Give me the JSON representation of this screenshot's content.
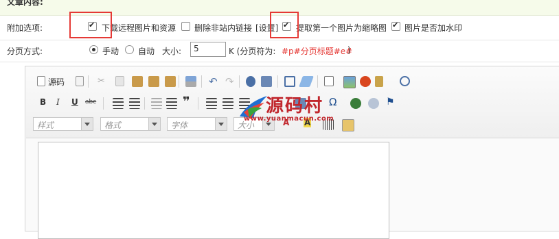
{
  "article": {
    "title": "文章内容:"
  },
  "options": {
    "label": "附加选项:",
    "items": [
      {
        "label": "下载远程图片和资源",
        "checked": true
      },
      {
        "label": "删除非站内链接",
        "checked": false
      },
      {
        "settings_link": "[设置]"
      },
      {
        "label": "提取第一个图片为缩略图",
        "checked": true
      },
      {
        "label": "图片是否加水印",
        "checked": true
      }
    ]
  },
  "paging": {
    "label": "分页方式:",
    "manual": "手动",
    "auto": "自动",
    "size_label": "大小:",
    "size_value": "5",
    "unit_prefix": "K (分页符为:",
    "separator_code": "#p#分页标题#e#",
    "unit_suffix": ")"
  },
  "editor": {
    "source_label": "源码",
    "combos": {
      "style": "样式",
      "format": "格式",
      "font": "字体",
      "size": "大小"
    }
  },
  "watermark": {
    "brand": "源码村",
    "url": "www.yuanmacun.com"
  },
  "colors": {
    "accent_red": "#e53935",
    "header_bg": "#f6fbea"
  }
}
